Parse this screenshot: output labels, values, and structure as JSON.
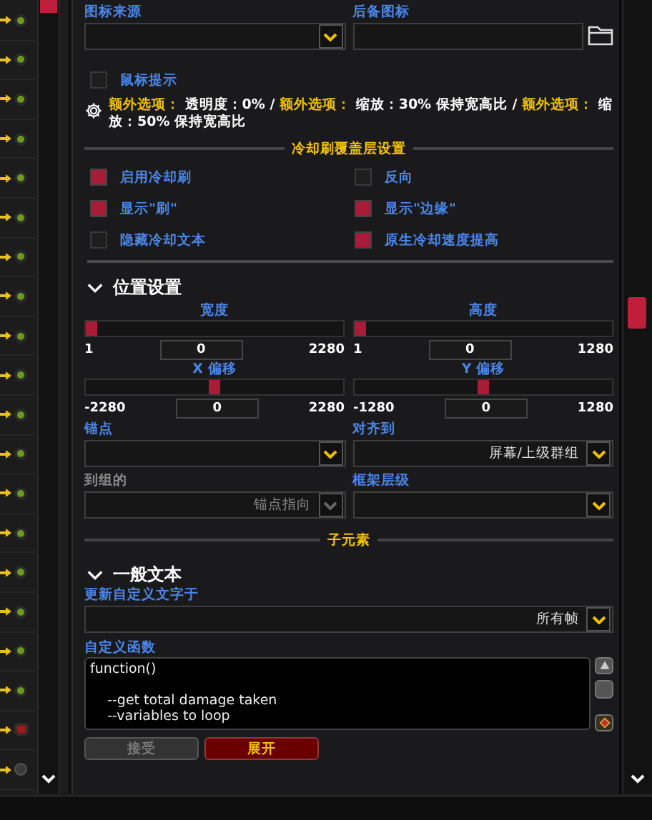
{
  "side_list": {
    "rows": [
      {
        "kind": "on"
      },
      {
        "kind": "on"
      },
      {
        "kind": "on"
      },
      {
        "kind": "on"
      },
      {
        "kind": "on"
      },
      {
        "kind": "on"
      },
      {
        "kind": "on"
      },
      {
        "kind": "on"
      },
      {
        "kind": "on"
      },
      {
        "kind": "on"
      },
      {
        "kind": "on"
      },
      {
        "kind": "on"
      },
      {
        "kind": "on"
      },
      {
        "kind": "on"
      },
      {
        "kind": "on"
      },
      {
        "kind": "on"
      },
      {
        "kind": "on"
      },
      {
        "kind": "on"
      },
      {
        "kind": "off"
      },
      {
        "kind": "idle"
      }
    ]
  },
  "top_fields": [
    {
      "kind": "dropdown",
      "label": "图标来源"
    },
    {
      "kind": "file",
      "label": "后备图标"
    }
  ],
  "mouse_tooltip": {
    "label": "鼠标提示",
    "checked": false
  },
  "summary": [
    {
      "kind": "key",
      "text": "额外选项："
    },
    {
      "kind": "plain",
      "text": " 透明度：0% / "
    },
    {
      "kind": "key",
      "text": "额外选项："
    },
    {
      "kind": "plain",
      "text": " 缩放：30% 保持宽高比 / "
    },
    {
      "kind": "key",
      "text": "额外选项："
    },
    {
      "kind": "plain",
      "text": " 缩放：50% 保持宽高比"
    }
  ],
  "cooldown_section": {
    "title": "冷却刷覆盖层设置",
    "options": [
      {
        "label": "启用冷却刷",
        "checked": true
      },
      {
        "label": "反向",
        "checked": false
      },
      {
        "label": "显示\"刷\"",
        "checked": true
      },
      {
        "label": "显示\"边缘\"",
        "checked": true
      },
      {
        "label": "隐藏冷却文本",
        "checked": false
      },
      {
        "label": "原生冷却速度提高",
        "checked": true
      }
    ]
  },
  "position": {
    "title": "位置设置",
    "expanded": true,
    "sliders": [
      {
        "label": "宽度",
        "min": "1",
        "value": "0",
        "max": "2280",
        "level": 0
      },
      {
        "label": "高度",
        "min": "1",
        "value": "0",
        "max": "1280",
        "level": 0
      },
      {
        "label": "X 偏移",
        "min": "-2280",
        "value": "0",
        "max": "2280",
        "level": 0.5
      },
      {
        "label": "Y 偏移",
        "min": "-1280",
        "value": "0",
        "max": "1280",
        "level": 0.5
      }
    ],
    "fields": [
      {
        "label": "锚点",
        "disabled": false
      },
      {
        "label": "对齐到",
        "value": "屏幕/上级群组",
        "disabled": false
      },
      {
        "label": "到组的",
        "value": "锚点指向",
        "disabled": true
      },
      {
        "label": "框架层级",
        "disabled": false
      }
    ]
  },
  "child_divider": "子元素",
  "general_text": {
    "title": "一般文本",
    "expanded": true,
    "update": {
      "label": "更新自定义文字于",
      "value": "所有帧"
    },
    "code": {
      "label": "自定义函数",
      "text": "function()\n\n    --get total damage taken\n    --variables to loop"
    },
    "buttons": [
      {
        "label": "接受",
        "kind": "accept",
        "disabled": true
      },
      {
        "label": "展开",
        "kind": "expand",
        "disabled": false
      }
    ]
  }
}
